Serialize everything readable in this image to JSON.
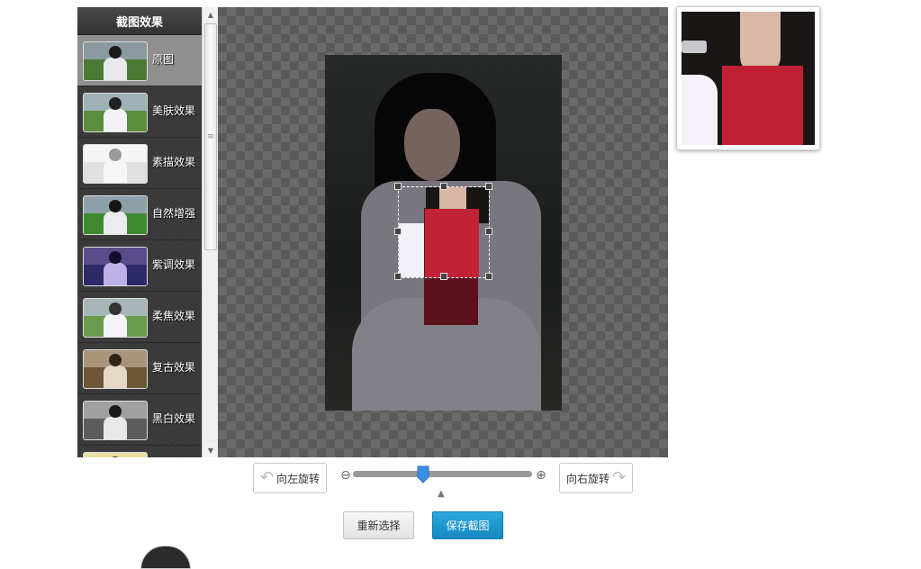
{
  "sidebar": {
    "title": "截图效果",
    "items": [
      {
        "label": "原图",
        "selected": true,
        "tint": {
          "sky": "#8b9aa0",
          "ground": "#4c7a35",
          "person": "#1a1a1a",
          "body": "#e8e8ea"
        }
      },
      {
        "label": "美肤效果",
        "selected": false,
        "tint": {
          "sky": "#9fb1b6",
          "ground": "#5b8d3f",
          "person": "#222222",
          "body": "#f2f2f4"
        }
      },
      {
        "label": "素描效果",
        "selected": false,
        "tint": {
          "sky": "#f5f5f5",
          "ground": "#e0e0e0",
          "person": "#999999",
          "body": "#f7f7f7"
        }
      },
      {
        "label": "自然增强",
        "selected": false,
        "tint": {
          "sky": "#8ea0a8",
          "ground": "#3f8a2f",
          "person": "#151515",
          "body": "#ececef"
        }
      },
      {
        "label": "紫调效果",
        "selected": false,
        "tint": {
          "sky": "#5b4c8c",
          "ground": "#2e2a68",
          "person": "#150f2e",
          "body": "#bcb0e6"
        }
      },
      {
        "label": "柔焦效果",
        "selected": false,
        "tint": {
          "sky": "#a7b5b9",
          "ground": "#6a9a4e",
          "person": "#333333",
          "body": "#f4f4f6"
        }
      },
      {
        "label": "复古效果",
        "selected": false,
        "tint": {
          "sky": "#a8947a",
          "ground": "#6e5637",
          "person": "#2e2418",
          "body": "#e4d8c6"
        }
      },
      {
        "label": "黑白效果",
        "selected": false,
        "tint": {
          "sky": "#a0a0a0",
          "ground": "#5c5c5c",
          "person": "#1a1a1a",
          "body": "#e8e8e8"
        }
      },
      {
        "label": "",
        "selected": false,
        "tint": {
          "sky": "#e8e0a0",
          "ground": "#c8c070",
          "person": "#333333",
          "body": "#f6f2d0"
        }
      }
    ]
  },
  "controls": {
    "rotate_left": "向左旋转",
    "rotate_right": "向右旋转",
    "rotate_left_glyph": "↶",
    "rotate_right_glyph": "↷",
    "zoom_out_glyph": "⊖",
    "zoom_in_glyph": "⊕",
    "zoom_fraction": 0.39,
    "reselect": "重新选择",
    "save": "保存截图"
  },
  "colors": {
    "accent": "#1a98d0",
    "slider_thumb": "#3a8ee6"
  }
}
